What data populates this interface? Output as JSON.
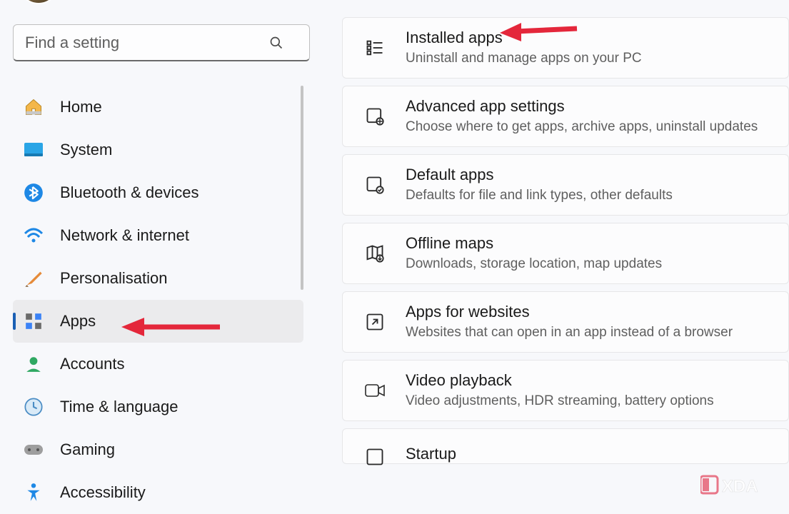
{
  "search": {
    "placeholder": "Find a setting"
  },
  "sidebar": {
    "items": [
      {
        "label": "Home"
      },
      {
        "label": "System"
      },
      {
        "label": "Bluetooth & devices"
      },
      {
        "label": "Network & internet"
      },
      {
        "label": "Personalisation"
      },
      {
        "label": "Apps"
      },
      {
        "label": "Accounts"
      },
      {
        "label": "Time & language"
      },
      {
        "label": "Gaming"
      },
      {
        "label": "Accessibility"
      }
    ],
    "selected_index": 5
  },
  "main": {
    "cards": [
      {
        "title": "Installed apps",
        "desc": "Uninstall and manage apps on your PC"
      },
      {
        "title": "Advanced app settings",
        "desc": "Choose where to get apps, archive apps, uninstall updates"
      },
      {
        "title": "Default apps",
        "desc": "Defaults for file and link types, other defaults"
      },
      {
        "title": "Offline maps",
        "desc": "Downloads, storage location, map updates"
      },
      {
        "title": "Apps for websites",
        "desc": "Websites that can open in an app instead of a browser"
      },
      {
        "title": "Video playback",
        "desc": "Video adjustments, HDR streaming, battery options"
      },
      {
        "title": "Startup",
        "desc": ""
      }
    ]
  },
  "watermark": "XDA",
  "annotations": {
    "arrow_top_target": "Installed apps",
    "arrow_side_target": "Apps"
  }
}
